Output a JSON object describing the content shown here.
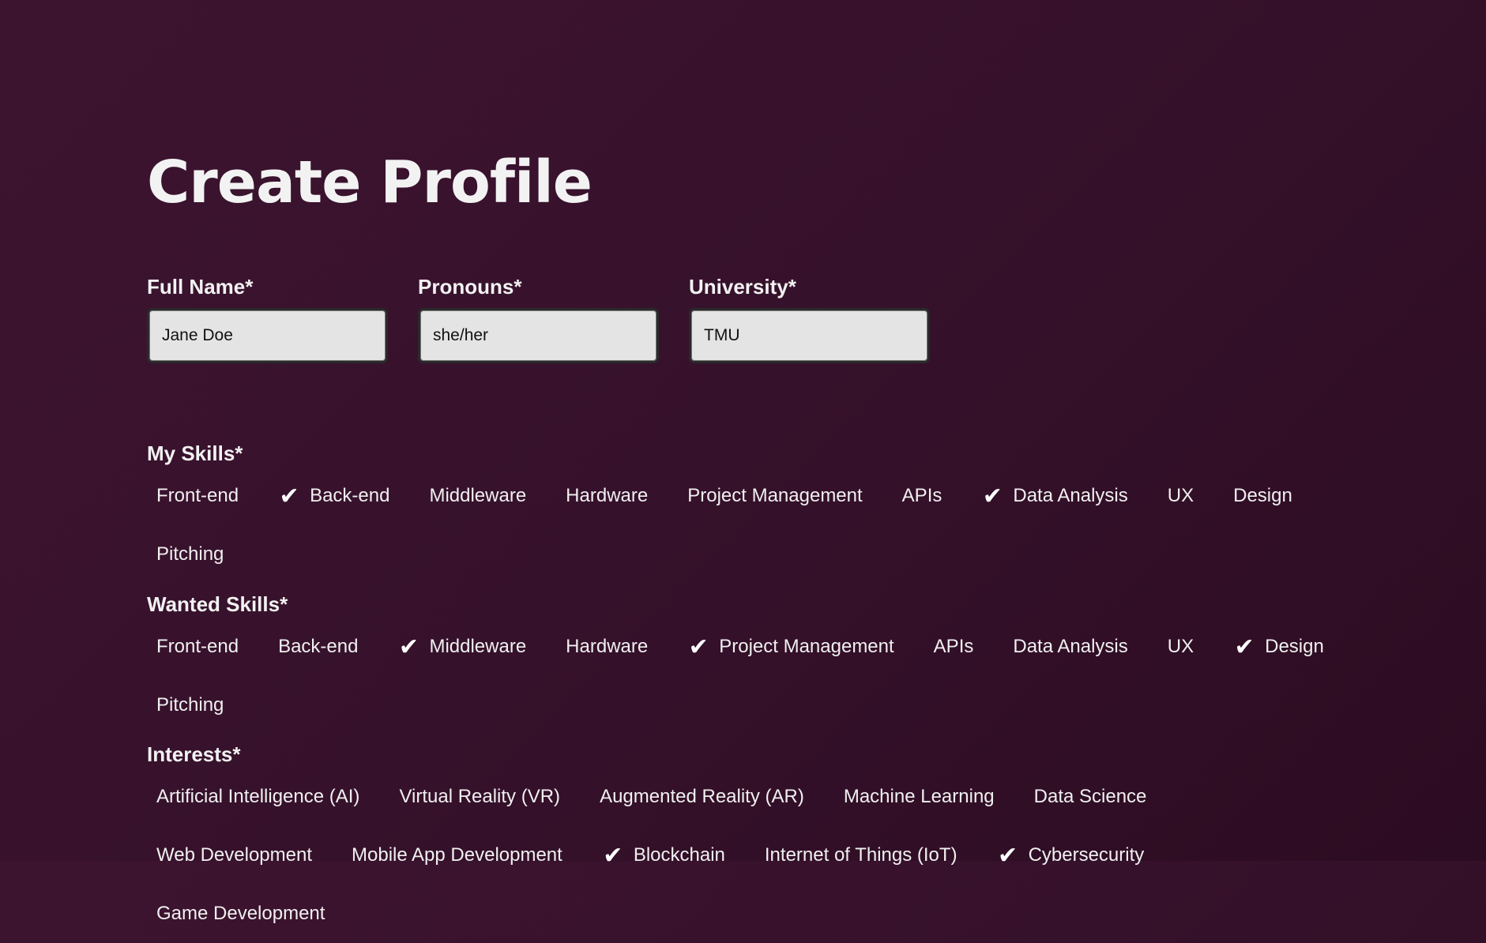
{
  "page": {
    "title": "Create Profile"
  },
  "fields": [
    {
      "label": "Full Name*",
      "value": "Jane Doe"
    },
    {
      "label": "Pronouns*",
      "value": "she/her"
    },
    {
      "label": "University*",
      "value": "TMU"
    }
  ],
  "my_skills": {
    "title": "My Skills*",
    "options": [
      {
        "label": "Front-end",
        "checked": false
      },
      {
        "label": "Back-end",
        "checked": true
      },
      {
        "label": "Middleware",
        "checked": false
      },
      {
        "label": "Hardware",
        "checked": false
      },
      {
        "label": "Project Management",
        "checked": false
      },
      {
        "label": "APIs",
        "checked": false
      },
      {
        "label": "Data Analysis",
        "checked": true
      },
      {
        "label": "UX",
        "checked": false
      },
      {
        "label": "Design",
        "checked": false
      },
      {
        "label": "Pitching",
        "checked": false
      }
    ]
  },
  "wanted_skills": {
    "title": "Wanted Skills*",
    "options": [
      {
        "label": "Front-end",
        "checked": false
      },
      {
        "label": "Back-end",
        "checked": false
      },
      {
        "label": "Middleware",
        "checked": true
      },
      {
        "label": "Hardware",
        "checked": false
      },
      {
        "label": "Project Management",
        "checked": true
      },
      {
        "label": "APIs",
        "checked": false
      },
      {
        "label": "Data Analysis",
        "checked": false
      },
      {
        "label": "UX",
        "checked": false
      },
      {
        "label": "Design",
        "checked": true
      },
      {
        "label": "Pitching",
        "checked": false
      }
    ]
  },
  "interests": {
    "title": "Interests*",
    "options": [
      {
        "label": "Artificial Intelligence (AI)",
        "checked": false
      },
      {
        "label": "Virtual Reality (VR)",
        "checked": false
      },
      {
        "label": "Augmented Reality (AR)",
        "checked": false
      },
      {
        "label": "Machine Learning",
        "checked": false
      },
      {
        "label": "Data Science",
        "checked": false
      },
      {
        "label": "Web Development",
        "checked": false
      },
      {
        "label": "Mobile App Development",
        "checked": false
      },
      {
        "label": "Blockchain",
        "checked": true
      },
      {
        "label": "Internet of Things (IoT)",
        "checked": false
      },
      {
        "label": "Cybersecurity",
        "checked": true
      },
      {
        "label": "Game Development",
        "checked": false
      }
    ]
  },
  "icons": {
    "check": "checkmark-icon"
  },
  "colors": {
    "background": "#36112b",
    "input_background": "#e4e4e4",
    "text": "#f0f0f0"
  }
}
